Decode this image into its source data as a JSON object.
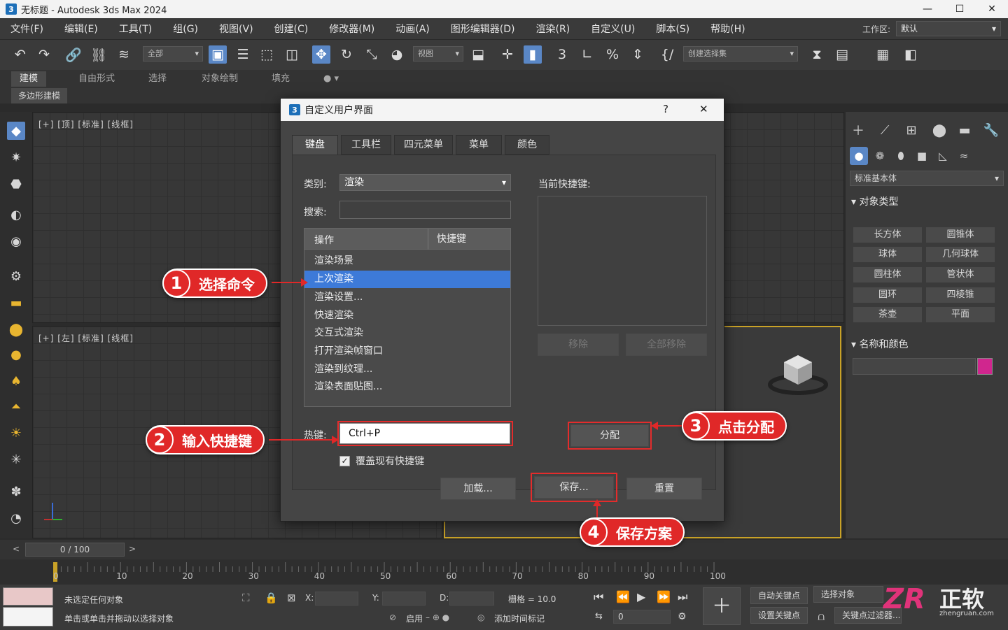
{
  "window": {
    "title": "无标题 - Autodesk 3ds Max 2024",
    "logo": "3",
    "controls": [
      "—",
      "☐",
      "✕"
    ]
  },
  "menubar": {
    "items": [
      "文件(F)",
      "编辑(E)",
      "工具(T)",
      "组(G)",
      "视图(V)",
      "创建(C)",
      "修改器(M)",
      "动画(A)",
      "图形编辑器(D)",
      "渲染(R)",
      "自定义(U)",
      "脚本(S)",
      "帮助(H)"
    ],
    "workspace_label": "工作区:",
    "workspace_value": "默认"
  },
  "toolbar": {
    "drop1": "全部",
    "drop2": "视图",
    "drop3": "创建选择集"
  },
  "ribbon": {
    "tabs": [
      "建模",
      "自由形式",
      "选择",
      "对象绘制",
      "填充"
    ],
    "sub": "多边形建模",
    "extra": "● ▾"
  },
  "viewports": {
    "top_label": "[+] [顶] [标准] [线框]",
    "left_label": "[+] [左] [标准] [线框]"
  },
  "right_panel": {
    "dropdown": "标准基本体",
    "section_object_type": "对象类型",
    "object_buttons": [
      "长方体",
      "圆锥体",
      "球体",
      "几何球体",
      "圆柱体",
      "管状体",
      "圆环",
      "四棱锥",
      "茶壶",
      "平面"
    ],
    "section_name_color": "名称和颜色",
    "color": "#d0268e"
  },
  "timeslider": {
    "value": "0 / 100",
    "left_arrow": "<",
    "right_arrow": ">"
  },
  "timeline": {
    "ticks": [
      "0",
      "10",
      "20",
      "30",
      "40",
      "50",
      "60",
      "70",
      "80",
      "90",
      "100"
    ]
  },
  "statusbar": {
    "line1": "未选定任何对象",
    "line2": "单击或单击并拖动以选择对象",
    "x_label": "X:",
    "y_label": "Y:",
    "z_label": "D:",
    "grid": "栅格 = 10.0",
    "enable": "启用",
    "add_time_tag": "添加时间标记",
    "auto_key": "自动关键点",
    "set_key": "设置关键点",
    "select_object": "选择对象",
    "key_filter": "关键点过滤器...",
    "frame_value": "0"
  },
  "dialog": {
    "title": "自定义用户界面",
    "help": "?",
    "close": "✕",
    "tabs": [
      "键盘",
      "工具栏",
      "四元菜单",
      "菜单",
      "颜色"
    ],
    "category_label": "类别:",
    "category_value": "渲染",
    "search_label": "搜索:",
    "list_headers": [
      "操作",
      "快捷键"
    ],
    "actions": [
      "渲染场景",
      "上次渲染",
      "渲染设置...",
      "快速渲染",
      "交互式渲染",
      "打开渲染帧窗口",
      "渲染到纹理...",
      "渲染表面贴图..."
    ],
    "selected_index": 1,
    "current_shortcut_label": "当前快捷键:",
    "remove": "移除",
    "remove_all": "全部移除",
    "hotkey_label": "热键:",
    "hotkey_value": "Ctrl+P",
    "assign": "分配",
    "override_label": "覆盖现有快捷键",
    "override_checked": "✓",
    "load": "加载...",
    "save": "保存...",
    "reset": "重置"
  },
  "callouts": [
    {
      "num": "1",
      "text": "选择命令"
    },
    {
      "num": "2",
      "text": "输入快捷键"
    },
    {
      "num": "3",
      "text": "点击分配"
    },
    {
      "num": "4",
      "text": "保存方案"
    }
  ],
  "watermark": {
    "brand": "正软",
    "site": "zhengruan.com",
    "logo": "ZR"
  }
}
